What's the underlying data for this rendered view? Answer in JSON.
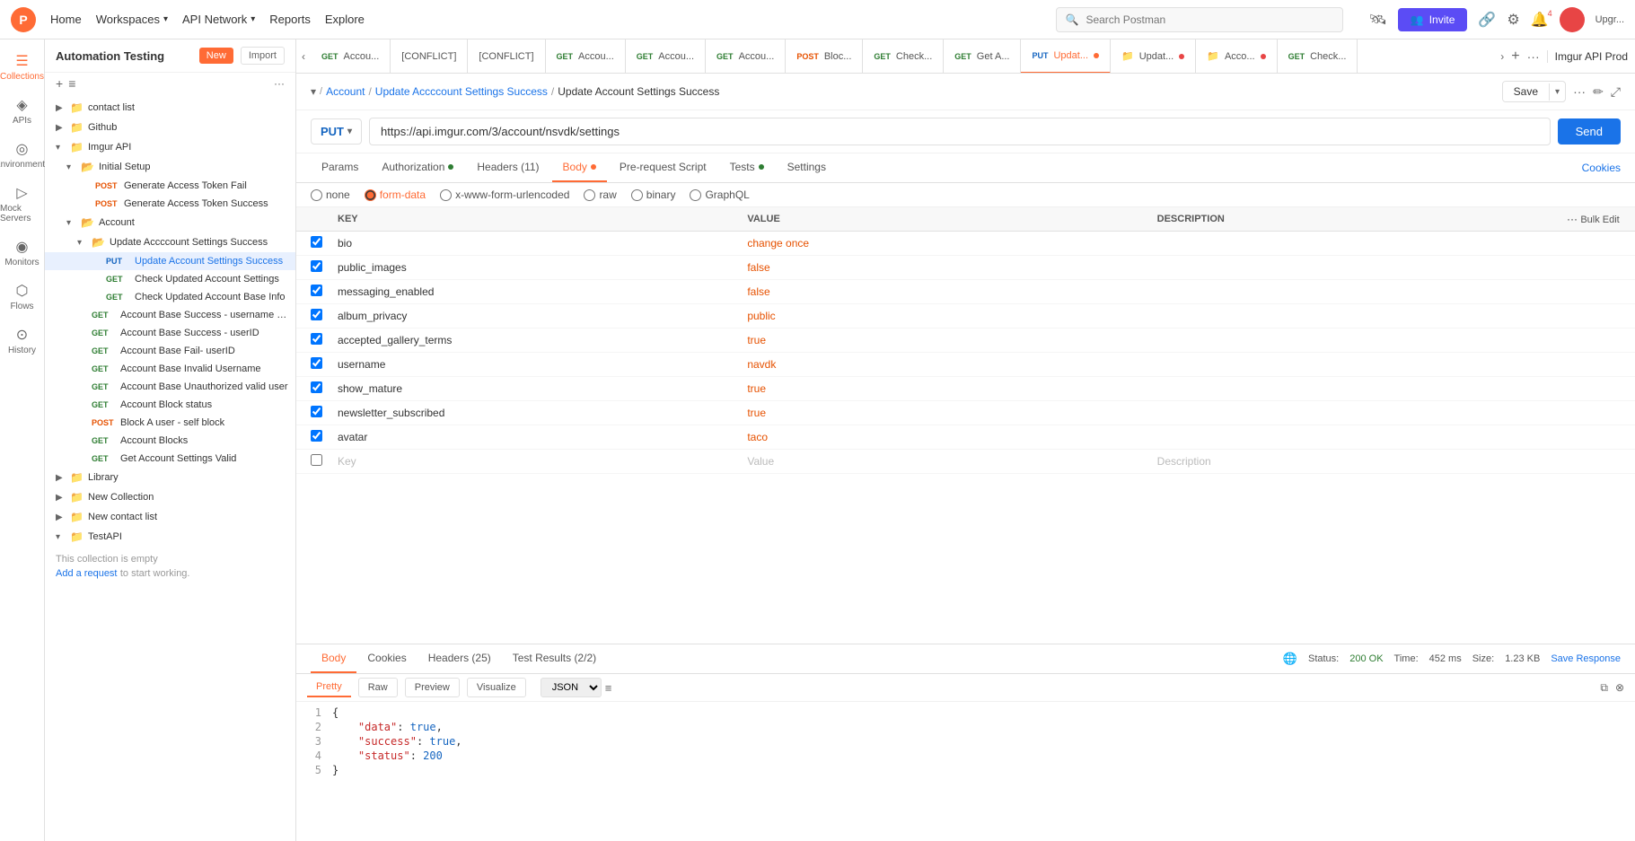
{
  "app": {
    "logo_text": "P",
    "nav_items": [
      {
        "label": "Home",
        "has_chevron": false
      },
      {
        "label": "Workspaces",
        "has_chevron": true
      },
      {
        "label": "API Network",
        "has_chevron": true
      },
      {
        "label": "Reports",
        "has_chevron": false
      },
      {
        "label": "Explore",
        "has_chevron": false
      }
    ],
    "search_placeholder": "Search Postman",
    "invite_label": "Invite",
    "upgrade_label": "Upgr...",
    "env_label": "Imgur API Prod"
  },
  "sidebar": {
    "title": "Automation Testing",
    "new_label": "New",
    "import_label": "Import",
    "icons": [
      {
        "name": "collections",
        "label": "Collections",
        "symbol": "⊟"
      },
      {
        "name": "apis",
        "label": "APIs",
        "symbol": "⊕"
      },
      {
        "name": "environments",
        "label": "Environments",
        "symbol": "◎"
      },
      {
        "name": "mock-servers",
        "label": "Mock Servers",
        "symbol": "▷"
      },
      {
        "name": "monitors",
        "label": "Monitors",
        "symbol": "◉"
      },
      {
        "name": "flows",
        "label": "Flows",
        "symbol": "⬡"
      },
      {
        "name": "history",
        "label": "History",
        "symbol": "⊙"
      }
    ],
    "collections": [
      {
        "id": "contact-list",
        "label": "contact list",
        "type": "collection",
        "depth": 0,
        "expanded": false
      },
      {
        "id": "github",
        "label": "Github",
        "type": "collection",
        "depth": 0,
        "expanded": false
      },
      {
        "id": "imgur-api",
        "label": "Imgur API",
        "type": "collection",
        "depth": 0,
        "expanded": true,
        "children": [
          {
            "id": "initial-setup",
            "label": "Initial Setup",
            "type": "folder",
            "depth": 1,
            "expanded": true,
            "children": [
              {
                "id": "gen-fail",
                "label": "Generate Access Token Fail",
                "method": "POST",
                "depth": 2
              },
              {
                "id": "gen-success",
                "label": "Generate Access Token Success",
                "method": "POST",
                "depth": 2
              }
            ]
          },
          {
            "id": "account",
            "label": "Account",
            "type": "folder",
            "depth": 1,
            "expanded": true,
            "children": [
              {
                "id": "update-acc-folder",
                "label": "Update Accccount Settings Success",
                "type": "folder",
                "depth": 2,
                "expanded": true,
                "children": [
                  {
                    "id": "put-update-acc",
                    "label": "Update Account Settings Success",
                    "method": "PUT",
                    "depth": 3,
                    "active": true
                  },
                  {
                    "id": "get-check-updated",
                    "label": "Check Updated Account Settings",
                    "method": "GET",
                    "depth": 3
                  },
                  {
                    "id": "get-check-base",
                    "label": "Check Updated Account Base Info",
                    "method": "GET",
                    "depth": 3
                  }
                ]
              },
              {
                "id": "acc-base-success-username",
                "label": "Account Base Success - username parameter",
                "method": "GET",
                "depth": 2
              },
              {
                "id": "acc-base-success-userid",
                "label": "Account Base Success - userID",
                "method": "GET",
                "depth": 2
              },
              {
                "id": "acc-base-fail-userid",
                "label": "Account Base Fail- userID",
                "method": "GET",
                "depth": 2
              },
              {
                "id": "acc-base-invalid",
                "label": "Account Base Invalid Username",
                "method": "GET",
                "depth": 2
              },
              {
                "id": "acc-base-unauth",
                "label": "Account Base Unauthorized valid user",
                "method": "GET",
                "depth": 2
              },
              {
                "id": "acc-block-status",
                "label": "Account Block status",
                "method": "GET",
                "depth": 2
              },
              {
                "id": "block-user",
                "label": "Block A user - self block",
                "method": "POST",
                "depth": 2
              },
              {
                "id": "acc-blocks",
                "label": "Account Blocks",
                "method": "GET",
                "depth": 2
              },
              {
                "id": "get-acc-settings",
                "label": "Get Account Settings Valid",
                "method": "GET",
                "depth": 2
              }
            ]
          }
        ]
      },
      {
        "id": "library",
        "label": "Library",
        "type": "collection",
        "depth": 0,
        "expanded": false
      },
      {
        "id": "new-collection",
        "label": "New Collection",
        "type": "collection",
        "depth": 0,
        "expanded": false
      },
      {
        "id": "new-contact-list",
        "label": "New contact list",
        "type": "collection",
        "depth": 0,
        "expanded": false
      },
      {
        "id": "testapi",
        "label": "TestAPI",
        "type": "collection",
        "depth": 0,
        "expanded": true,
        "children": []
      }
    ],
    "empty_collection_msg": "This collection is empty",
    "add_request_link": "Add a request",
    "add_request_suffix": " to start working."
  },
  "tabs": [
    {
      "id": "tab1",
      "method": "GET",
      "method_color": "#2e7d32",
      "label": "GET Accou...",
      "dot_color": ""
    },
    {
      "id": "tab2",
      "method": "[CONFLICT]",
      "method_color": "#e65100",
      "label": "[CONFLICT]",
      "dot_color": ""
    },
    {
      "id": "tab3",
      "method": "[CONFLICT]",
      "method_color": "#e65100",
      "label": "[CONFLICT]",
      "dot_color": ""
    },
    {
      "id": "tab4",
      "method": "GET",
      "method_color": "#2e7d32",
      "label": "GET Accou...",
      "dot_color": ""
    },
    {
      "id": "tab5",
      "method": "GET",
      "method_color": "#2e7d32",
      "label": "GET Accou...",
      "dot_color": ""
    },
    {
      "id": "tab6",
      "method": "GET",
      "method_color": "#2e7d32",
      "label": "GET Accou...",
      "dot_color": ""
    },
    {
      "id": "tab7",
      "method": "POST",
      "method_color": "#e65100",
      "label": "POST Bloc...",
      "dot_color": ""
    },
    {
      "id": "tab8",
      "method": "GET",
      "method_color": "#2e7d32",
      "label": "GET Check...",
      "dot_color": ""
    },
    {
      "id": "tab9",
      "method": "GET",
      "method_color": "#2e7d32",
      "label": "GET Get A...",
      "dot_color": ""
    },
    {
      "id": "tab10",
      "method": "PUT",
      "method_color": "#1565c0",
      "label": "PUT Updat...",
      "dot_color": "#ff6b35",
      "active": true
    },
    {
      "id": "tab11",
      "method": "folder",
      "method_color": "#666",
      "label": "Updat...",
      "dot_color": "#e84545"
    },
    {
      "id": "tab12",
      "method": "folder",
      "method_color": "#666",
      "label": "Acco...",
      "dot_color": "#e84545"
    },
    {
      "id": "tab13",
      "method": "GET",
      "method_color": "#2e7d32",
      "label": "GET Check...",
      "dot_color": ""
    }
  ],
  "breadcrumb": {
    "parts": [
      "Account",
      "Update Accccount Settings Success"
    ],
    "current": "Update Account Settings Success"
  },
  "request": {
    "method": "PUT",
    "url": "https://api.imgur.com/3/account/nsvdk/settings",
    "send_label": "Send",
    "tabs": [
      {
        "id": "params",
        "label": "Params"
      },
      {
        "id": "authorization",
        "label": "Authorization",
        "dot_color": "#2e7d32"
      },
      {
        "id": "headers",
        "label": "Headers (11)",
        "dot_color": ""
      },
      {
        "id": "body",
        "label": "Body",
        "dot_color": "#ff6b35",
        "active": true
      },
      {
        "id": "pre-request",
        "label": "Pre-request Script"
      },
      {
        "id": "tests",
        "label": "Tests",
        "dot_color": "#2e7d32"
      },
      {
        "id": "settings",
        "label": "Settings"
      }
    ],
    "body_options": [
      {
        "id": "none",
        "label": "none"
      },
      {
        "id": "form-data",
        "label": "form-data",
        "active": true
      },
      {
        "id": "urlencoded",
        "label": "x-www-form-urlencoded"
      },
      {
        "id": "raw",
        "label": "raw"
      },
      {
        "id": "binary",
        "label": "binary"
      },
      {
        "id": "graphql",
        "label": "GraphQL"
      }
    ],
    "kv_columns": {
      "key": "KEY",
      "value": "VALUE",
      "description": "DESCRIPTION"
    },
    "kv_rows": [
      {
        "checked": true,
        "key": "bio",
        "value": "change once",
        "desc": ""
      },
      {
        "checked": true,
        "key": "public_images",
        "value": "false",
        "desc": ""
      },
      {
        "checked": true,
        "key": "messaging_enabled",
        "value": "false",
        "desc": ""
      },
      {
        "checked": true,
        "key": "album_privacy",
        "value": "public",
        "desc": ""
      },
      {
        "checked": true,
        "key": "accepted_gallery_terms",
        "value": "true",
        "desc": ""
      },
      {
        "checked": true,
        "key": "username",
        "value": "navdk",
        "desc": ""
      },
      {
        "checked": true,
        "key": "show_mature",
        "value": "true",
        "desc": ""
      },
      {
        "checked": true,
        "key": "newsletter_subscribed",
        "value": "true",
        "desc": ""
      },
      {
        "checked": true,
        "key": "avatar",
        "value": "taco",
        "desc": ""
      },
      {
        "checked": false,
        "key": "Key",
        "value": "Value",
        "desc": "Description",
        "empty": true
      }
    ]
  },
  "response": {
    "tabs": [
      {
        "id": "body",
        "label": "Body",
        "active": true
      },
      {
        "id": "cookies",
        "label": "Cookies"
      },
      {
        "id": "headers",
        "label": "Headers (25)"
      },
      {
        "id": "test-results",
        "label": "Test Results (2/2)"
      }
    ],
    "status": "200 OK",
    "time": "452 ms",
    "size": "1.23 KB",
    "save_response_label": "Save Response",
    "body_tabs": [
      {
        "id": "pretty",
        "label": "Pretty",
        "active": true
      },
      {
        "id": "raw",
        "label": "Raw"
      },
      {
        "id": "preview",
        "label": "Preview"
      },
      {
        "id": "visualize",
        "label": "Visualize"
      }
    ],
    "format": "JSON",
    "code_lines": [
      {
        "num": "1",
        "content": "{",
        "type": "brace"
      },
      {
        "num": "2",
        "content": "\"data\": true,",
        "type": "kv",
        "key": "data",
        "val": "true"
      },
      {
        "num": "3",
        "content": "\"success\": true,",
        "type": "kv",
        "key": "success",
        "val": "true"
      },
      {
        "num": "4",
        "content": "\"status\": 200",
        "type": "kv",
        "key": "status",
        "val": "200"
      },
      {
        "num": "5",
        "content": "}",
        "type": "brace"
      }
    ]
  }
}
